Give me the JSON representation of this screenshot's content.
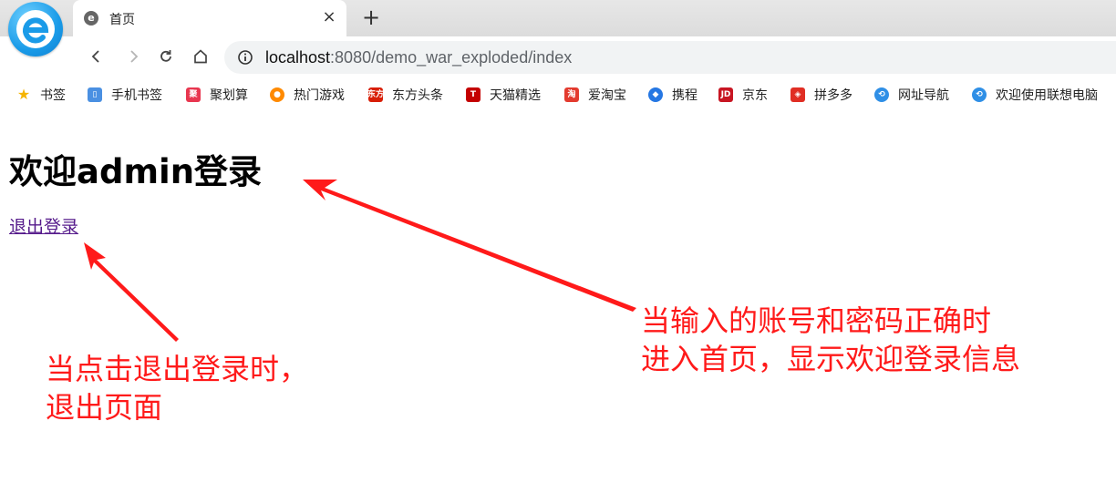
{
  "tab": {
    "title": "首页",
    "favicon": "e-browser-icon",
    "close_glyph": "×",
    "new_tab_glyph": "+"
  },
  "navigation": {
    "back_icon": "chevron-left-icon",
    "forward_icon": "chevron-right-icon",
    "reload_icon": "reload-icon",
    "home_icon": "home-icon",
    "info_icon": "info-icon"
  },
  "address_bar": {
    "host": "localhost",
    "rest": ":8080/demo_war_exploded/index"
  },
  "bookmarks": [
    {
      "label": "书签",
      "icon": "star-icon",
      "color": "#f5b400",
      "glyph": "★"
    },
    {
      "label": "手机书签",
      "icon": "phone-icon",
      "color": "#4a90e2",
      "glyph": "▯"
    },
    {
      "label": "聚划算",
      "icon": "juhuasuan-icon",
      "color": "#e8364f",
      "glyph": "聚"
    },
    {
      "label": "热门游戏",
      "icon": "game-icon",
      "color": "#ff8a00",
      "glyph": "●"
    },
    {
      "label": "东方头条",
      "icon": "dongfang-icon",
      "color": "#d81e06",
      "glyph": "东方"
    },
    {
      "label": "天猫精选",
      "icon": "tmall-icon",
      "color": "#c40000",
      "glyph": "T"
    },
    {
      "label": "爱淘宝",
      "icon": "taobao-icon",
      "color": "#e33b2f",
      "glyph": "淘"
    },
    {
      "label": "携程",
      "icon": "ctrip-icon",
      "color": "#2577e3",
      "glyph": "◆"
    },
    {
      "label": "京东",
      "icon": "jd-icon",
      "color": "#c81623",
      "glyph": "JD"
    },
    {
      "label": "拼多多",
      "icon": "pinduoduo-icon",
      "color": "#e02e24",
      "glyph": "◈"
    },
    {
      "label": "网址导航",
      "icon": "nav-site-icon",
      "color": "#2f8fe6",
      "glyph": "⟲"
    },
    {
      "label": "欢迎使用联想电脑",
      "icon": "lenovo-icon",
      "color": "#2f8fe6",
      "glyph": "⟲"
    }
  ],
  "page": {
    "heading": "欢迎admin登录",
    "logout_link": "退出登录"
  },
  "annotations": {
    "right": [
      "当输入的账号和密码正确时",
      "进入首页，显示欢迎登录信息"
    ],
    "left": [
      "当点击退出登录时，",
      "退出页面"
    ],
    "color": "#ff1a1a"
  }
}
